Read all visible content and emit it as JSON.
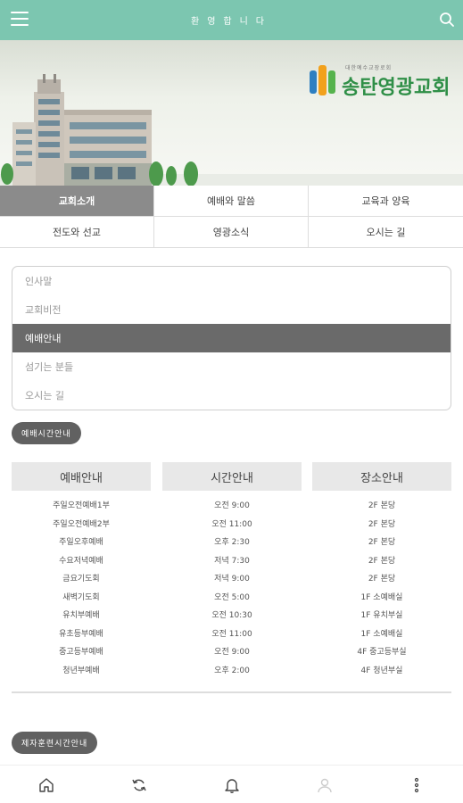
{
  "header": {
    "title": "환영합니다"
  },
  "logo": {
    "small_text": "대한예수교장로회",
    "name": "송탄영광교회"
  },
  "tabs": [
    {
      "label": "교회소개",
      "active": true
    },
    {
      "label": "예배와 말씀",
      "active": false
    },
    {
      "label": "교육과 양육",
      "active": false
    },
    {
      "label": "전도와 선교",
      "active": false
    },
    {
      "label": "영광소식",
      "active": false
    },
    {
      "label": "오시는 길",
      "active": false
    }
  ],
  "submenu": [
    {
      "label": "인사말",
      "active": false
    },
    {
      "label": "교회비전",
      "active": false
    },
    {
      "label": "예배안내",
      "active": true
    },
    {
      "label": "섬기는 분들",
      "active": false
    },
    {
      "label": "오시는 길",
      "active": false
    }
  ],
  "section1_label": "예배시간안내",
  "section2_label": "제자훈련시간안내",
  "table": {
    "headers": [
      "예배안내",
      "시간안내",
      "장소안내"
    ],
    "rows": [
      [
        "주일오전예배1부",
        "오전 9:00",
        "2F 본당"
      ],
      [
        "주일오전예배2부",
        "오전 11:00",
        "2F 본당"
      ],
      [
        "주일오후예배",
        "오후 2:30",
        "2F 본당"
      ],
      [
        "수요저녁예배",
        "저녁 7:30",
        "2F 본당"
      ],
      [
        "금요기도회",
        "저녁 9:00",
        "2F 본당"
      ],
      [
        "새벽기도회",
        "오전 5:00",
        "1F 소예배실"
      ],
      [
        "유치부예배",
        "오전 10:30",
        "1F 유치부실"
      ],
      [
        "유초등부예배",
        "오전 11:00",
        "1F 소예배실"
      ],
      [
        "중고등부예배",
        "오전 9:00",
        "4F 중고등부실"
      ],
      [
        "청년부예배",
        "오후 2:00",
        "4F 청년부실"
      ]
    ]
  },
  "bottom_nav": [
    "home-icon",
    "refresh-icon",
    "bell-icon",
    "user-icon",
    "more-icon"
  ],
  "colors": {
    "appbar": "#7cc6b0",
    "active_tab": "#8b8b8b",
    "active_submenu": "#6a6a6a",
    "pill": "#616161"
  }
}
